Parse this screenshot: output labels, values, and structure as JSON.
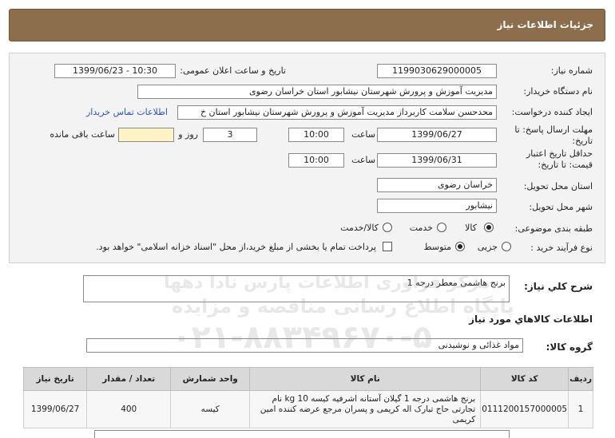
{
  "header": {
    "title": "جزئیات اطلاعات نیاز"
  },
  "fields": {
    "need_number_label": "شماره نیاز:",
    "need_number": "1199030629000005",
    "announce_label": "تاریخ و ساعت اعلان عمومی:",
    "announce_value": "1399/06/23 - 10:30",
    "buyer_label": "نام دستگاه خریدار:",
    "buyer_value": "مدیریت آموزش و پرورش شهرستان نیشابور استان خراسان رضوی",
    "creator_label": "ایجاد کننده درخواست:",
    "creator_value": "محدحسن سلامت کاربرداز مدیریت آموزش و پرورش شهرستان نیشابور استان خ",
    "contact_link": "اطلاعات تماس خریدار",
    "deadline_label": "مهلت ارسال پاسخ: تا تاریخ:",
    "deadline_date": "1399/06/27",
    "time_label": "ساعت",
    "deadline_time": "10:00",
    "days_value": "3",
    "days_label": "روز و",
    "remaining_value": "",
    "remaining_label": "ساعت باقی مانده",
    "validity_label": "حداقل تاریخ اعتبار قیمت: تا تاریخ:",
    "validity_date": "1399/06/31",
    "validity_time": "10:00",
    "province_label": "استان محل تحویل:",
    "province_value": "خراسان رضوی",
    "city_label": "شهر محل تحویل:",
    "city_value": "نیشابور",
    "category_label": "طبقه بندی موضوعی:",
    "category_options": [
      "کالا",
      "خدمت",
      "کالا/خدمت"
    ],
    "category_selected": "کالا",
    "process_label": "نوع فرآیند خرید :",
    "process_options": [
      "جزیی",
      "متوسط"
    ],
    "process_selected": "متوسط",
    "payment_note": "پرداخت تمام یا بخشی از مبلغ خرید،از محل \"اسناد خزانه اسلامی\" خواهد بود."
  },
  "description": {
    "label": "شرح کلي نياز:",
    "value": "برنج هاشمی معطر درجه 1"
  },
  "goods": {
    "section_title": "اطلاعات کالاهاي مورد نياز",
    "group_label": "گروه کالا:",
    "group_value": "مواد غذائی و نوشیدنی",
    "columns": [
      "ردیف",
      "کد کالا",
      "نام کالا",
      "واحد شمارش",
      "تعداد / مقدار",
      "تاریخ نیاز"
    ],
    "rows": [
      {
        "index": "1",
        "code": "0111200157000005",
        "name": "برنج هاشمی درجه 1 گیلان آستانه اشرفیه کیسه 10 kg نام تجارتی حاج تبارک اله کریمی و پسران مرجع عرضه کننده امین کریمی",
        "unit": "کیسه",
        "qty": "400",
        "date": "1399/06/27"
      }
    ]
  },
  "watermark": {
    "line1": "مرکز فراوری اطلاعات پارس نادا دهها",
    "line2": "پایگاه اطلاع رسانی مناقصه و مزایده",
    "line3": "۰۲۱-۸۸۳۴۹۶۷۰-۵"
  }
}
